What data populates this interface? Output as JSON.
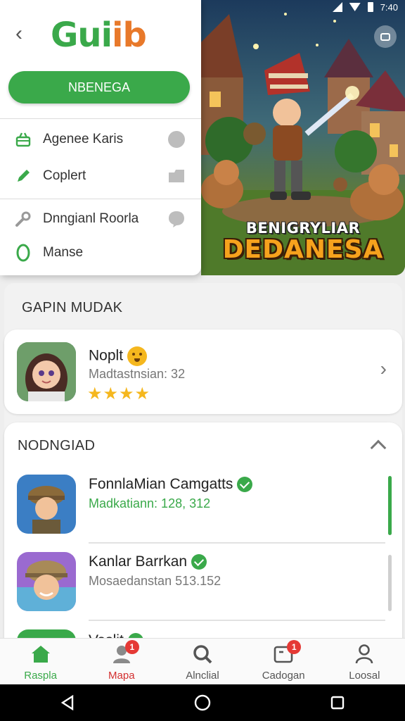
{
  "status_bar": {
    "time": "7:40",
    "icons": [
      "signal-icon",
      "wifi-icon",
      "battery-icon"
    ]
  },
  "drawer": {
    "logo": {
      "part1": "Gui",
      "part2": "ib"
    },
    "primary_button": "NBENEGA",
    "items": [
      {
        "label": "Agenee Karis",
        "icon": "basket-icon",
        "trailing_icon": "circle-icon"
      },
      {
        "label": "Coplert",
        "icon": "pencil-icon",
        "trailing_icon": "folder-icon"
      },
      {
        "label": "Dnngianl Roorla",
        "icon": "wrench-icon",
        "trailing_icon": "chat-bubble-icon"
      },
      {
        "label": "Manse",
        "icon": "ring-icon",
        "trailing_icon": ""
      }
    ]
  },
  "hero": {
    "subtitle": "BENIGRYLIAR",
    "title": "DEDANESA"
  },
  "featured": {
    "section_title": "GAPIN MUDAK",
    "app": {
      "name": "Noplt",
      "subtitle": "Madtastnsian: 32",
      "stars": "★★★★",
      "rating_stars": 4
    }
  },
  "list": {
    "section_title": "NODNGIAD",
    "apps": [
      {
        "name": "FonnlaMian Camgatts",
        "subtitle": "Madkatiann: 128, 312",
        "highlight": true
      },
      {
        "name": "Kanlar Barrkan",
        "subtitle": "Mosaedanstan 513.152",
        "highlight": false
      },
      {
        "name": "Vaslit",
        "subtitle": "",
        "highlight": false
      }
    ]
  },
  "bottom_nav": [
    {
      "label": "Raspla",
      "icon": "home-icon",
      "state": "active",
      "badge": ""
    },
    {
      "label": "Mapa",
      "icon": "person-icon",
      "state": "alert",
      "badge": "1"
    },
    {
      "label": "Alnclial",
      "icon": "search-icon",
      "state": "normal",
      "badge": ""
    },
    {
      "label": "Cadogan",
      "icon": "inbox-icon",
      "state": "normal",
      "badge": "1"
    },
    {
      "label": "Loosal",
      "icon": "profile-icon",
      "state": "normal",
      "badge": ""
    }
  ],
  "colors": {
    "accent": "#3aa94a",
    "logo_orange": "#e8792a",
    "badge_red": "#e53935",
    "star": "#f5b71e",
    "hero_title": "#f6a21d"
  }
}
